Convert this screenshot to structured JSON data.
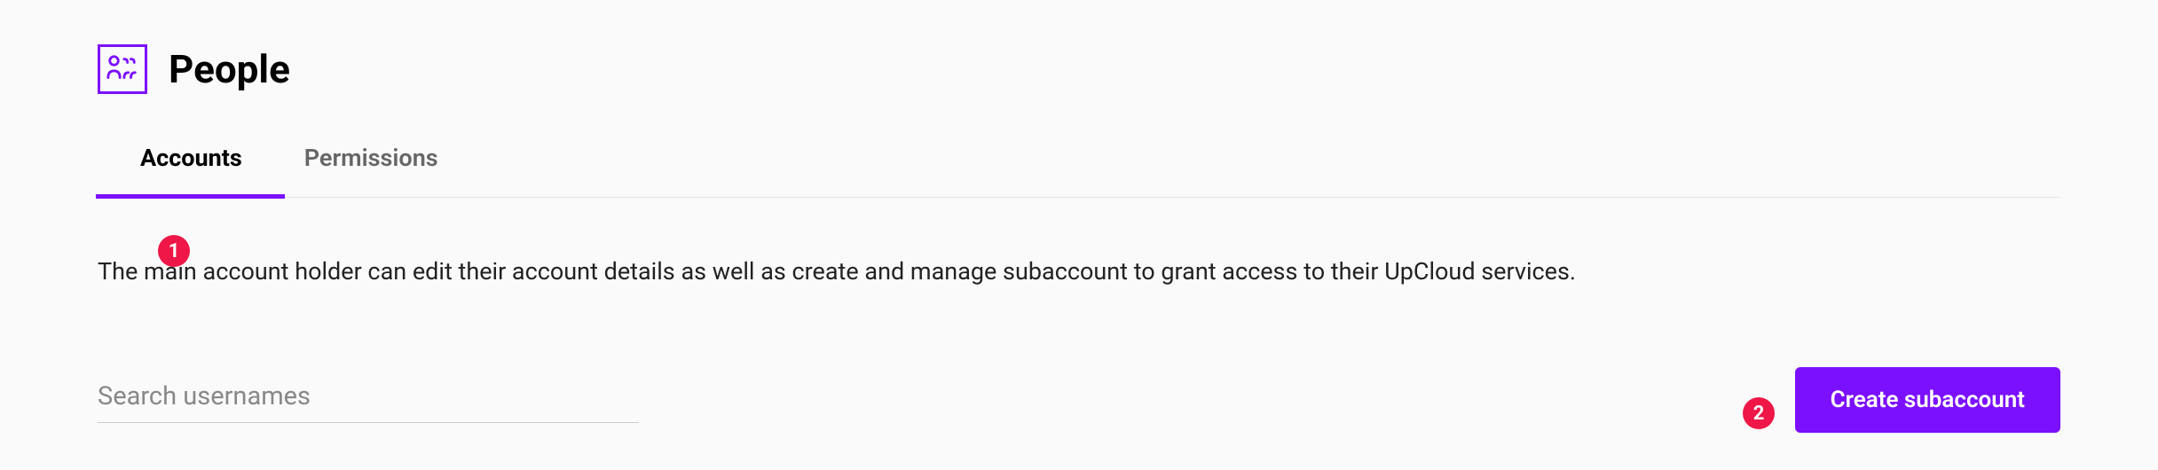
{
  "header": {
    "title": "People"
  },
  "tabs": [
    {
      "label": "Accounts",
      "active": true
    },
    {
      "label": "Permissions",
      "active": false
    }
  ],
  "description": "The main account holder can edit their account details as well as create and manage subaccount to grant access to their UpCloud services.",
  "search": {
    "placeholder": "Search usernames",
    "value": ""
  },
  "actions": {
    "create_subaccount": "Create subaccount"
  },
  "annotations": {
    "badge1": "1",
    "badge2": "2"
  }
}
